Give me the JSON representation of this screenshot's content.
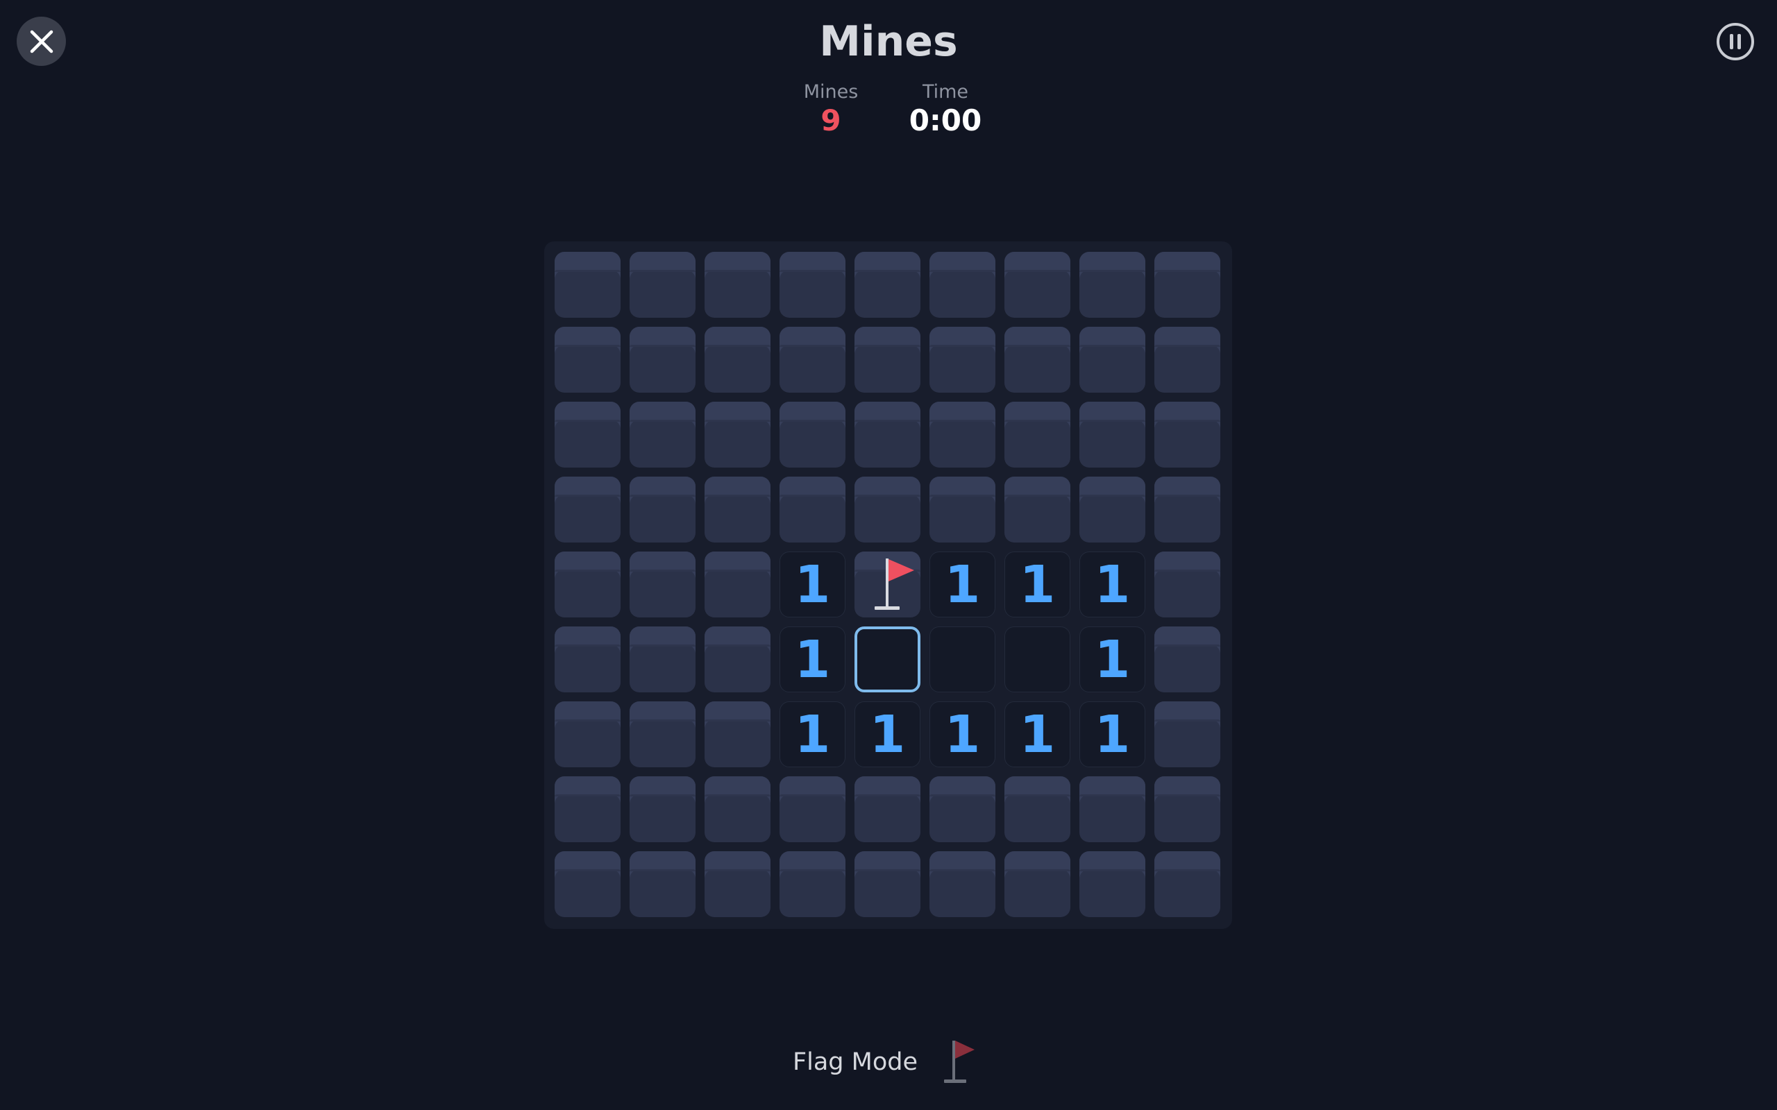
{
  "header": {
    "title": "Mines",
    "close_icon": "close-icon",
    "pause_icon": "pause-icon"
  },
  "stats": {
    "mines_label": "Mines",
    "mines_value": "9",
    "time_label": "Time",
    "time_value": "0:00"
  },
  "board": {
    "rows": 9,
    "cols": 9,
    "grid": [
      [
        "H",
        "H",
        "H",
        "H",
        "H",
        "H",
        "H",
        "H",
        "H"
      ],
      [
        "H",
        "H",
        "H",
        "H",
        "H",
        "H",
        "H",
        "H",
        "H"
      ],
      [
        "H",
        "H",
        "H",
        "H",
        "H",
        "H",
        "H",
        "H",
        "H"
      ],
      [
        "H",
        "H",
        "H",
        "H",
        "H",
        "H",
        "H",
        "H",
        "H"
      ],
      [
        "H",
        "H",
        "H",
        "1",
        "F",
        "1",
        "1",
        "1",
        "H"
      ],
      [
        "H",
        "H",
        "H",
        "1",
        "S",
        "0",
        "0",
        "1",
        "H"
      ],
      [
        "H",
        "H",
        "H",
        "1",
        "1",
        "1",
        "1",
        "1",
        "H"
      ],
      [
        "H",
        "H",
        "H",
        "H",
        "H",
        "H",
        "H",
        "H",
        "H"
      ],
      [
        "H",
        "H",
        "H",
        "H",
        "H",
        "H",
        "H",
        "H",
        "H"
      ]
    ],
    "legend": {
      "H": "hidden",
      "F": "flagged",
      "S": "selected-empty",
      "0": "revealed-empty",
      "1": "number-1"
    }
  },
  "footer": {
    "flag_mode_label": "Flag Mode",
    "flag_mode_icon": "flag-icon",
    "flag_mode_on": false
  },
  "colors": {
    "background": "#111522",
    "mines_count": "#f0525f",
    "number_one": "#4ea6ff",
    "flag": "#ef5060",
    "selected_border": "#7fbbec"
  }
}
